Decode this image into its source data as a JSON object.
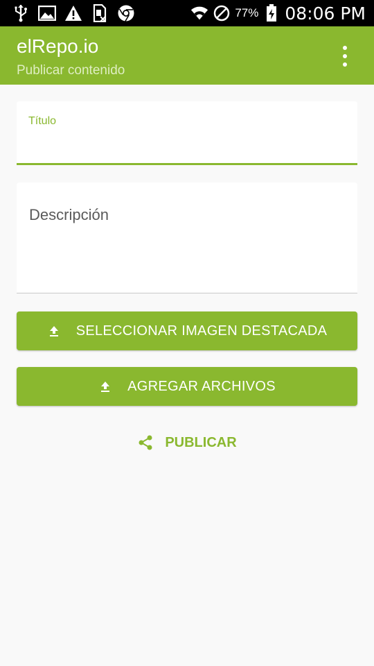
{
  "status_bar": {
    "battery_percent": "77%",
    "time": "08:06 PM",
    "icons": [
      "usb-icon",
      "image-icon",
      "warning-icon",
      "sim-icon",
      "chrome-icon",
      "wifi-icon",
      "no-disturb-icon",
      "battery-charging-icon"
    ]
  },
  "app_bar": {
    "title": "elRepo.io",
    "subtitle": "Publicar contenido",
    "menu_icon": "more-vert-icon"
  },
  "form": {
    "title_label": "Título",
    "title_value": "",
    "description_placeholder": "Descripción",
    "description_value": ""
  },
  "actions": {
    "select_image_label": "SELECCIONAR IMAGEN DESTACADA",
    "add_files_label": "AGREGAR ARCHIVOS",
    "publish_label": "PUBLICAR"
  },
  "colors": {
    "accent": "#8ab82f",
    "background": "#f9f9f9",
    "status_bar": "#000000"
  }
}
